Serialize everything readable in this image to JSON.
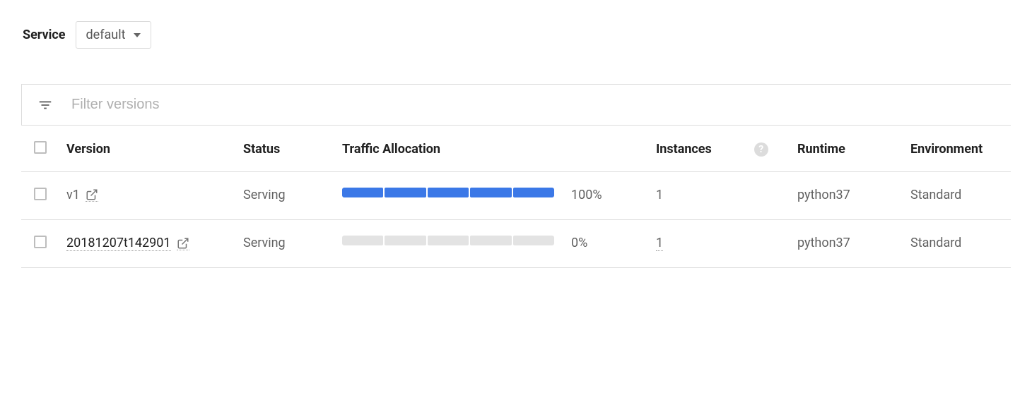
{
  "service": {
    "label": "Service",
    "selected": "default"
  },
  "filter": {
    "placeholder": "Filter versions"
  },
  "columns": {
    "version": "Version",
    "status": "Status",
    "traffic": "Traffic Allocation",
    "instances": "Instances",
    "runtime": "Runtime",
    "environment": "Environment"
  },
  "rows": [
    {
      "version": "v1",
      "is_link": false,
      "status": "Serving",
      "traffic_pct": "100%",
      "traffic_fill_segments": 5,
      "instances": "1",
      "instances_link": false,
      "runtime": "python37",
      "environment": "Standard"
    },
    {
      "version": "20181207t142901",
      "is_link": true,
      "status": "Serving",
      "traffic_pct": "0%",
      "traffic_fill_segments": 0,
      "instances": "1",
      "instances_link": true,
      "runtime": "python37",
      "environment": "Standard"
    }
  ]
}
